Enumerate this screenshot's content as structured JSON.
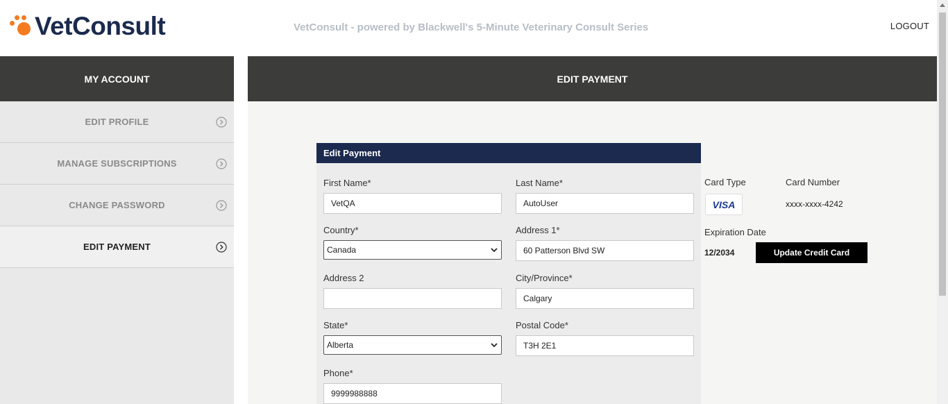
{
  "header": {
    "logo_text": "VetConsult",
    "tagline": "VetConsult - powered by Blackwell's 5-Minute Veterinary Consult Series",
    "logout_label": "LOGOUT"
  },
  "sidebar": {
    "title": "MY ACCOUNT",
    "items": [
      {
        "label": "EDIT PROFILE"
      },
      {
        "label": "MANAGE SUBSCRIPTIONS"
      },
      {
        "label": "CHANGE PASSWORD"
      },
      {
        "label": "EDIT PAYMENT"
      }
    ]
  },
  "main": {
    "title": "EDIT PAYMENT"
  },
  "form": {
    "title": "Edit Payment",
    "first_name_label": "First Name*",
    "first_name_value": "VetQA",
    "last_name_label": "Last Name*",
    "last_name_value": "AutoUser",
    "country_label": "Country*",
    "country_value": "Canada",
    "address1_label": "Address 1*",
    "address1_value": "60 Patterson Blvd SW",
    "address2_label": "Address 2",
    "address2_value": "",
    "city_label": "City/Province*",
    "city_value": "Calgary",
    "state_label": "State*",
    "state_value": "Alberta",
    "postal_label": "Postal Code*",
    "postal_value": "T3H 2E1",
    "phone_label": "Phone*",
    "phone_value": "9999988888"
  },
  "card": {
    "type_label": "Card Type",
    "type_value": "VISA",
    "number_label": "Card Number",
    "number_value": "xxxx-xxxx-4242",
    "expiration_label": "Expiration Date",
    "expiration_value": "12/2034",
    "update_label": "Update Credit Card"
  },
  "colors": {
    "brand_orange": "#f47b20",
    "brand_navy": "#1b2a4e",
    "header_dark": "#3c3c3a"
  }
}
